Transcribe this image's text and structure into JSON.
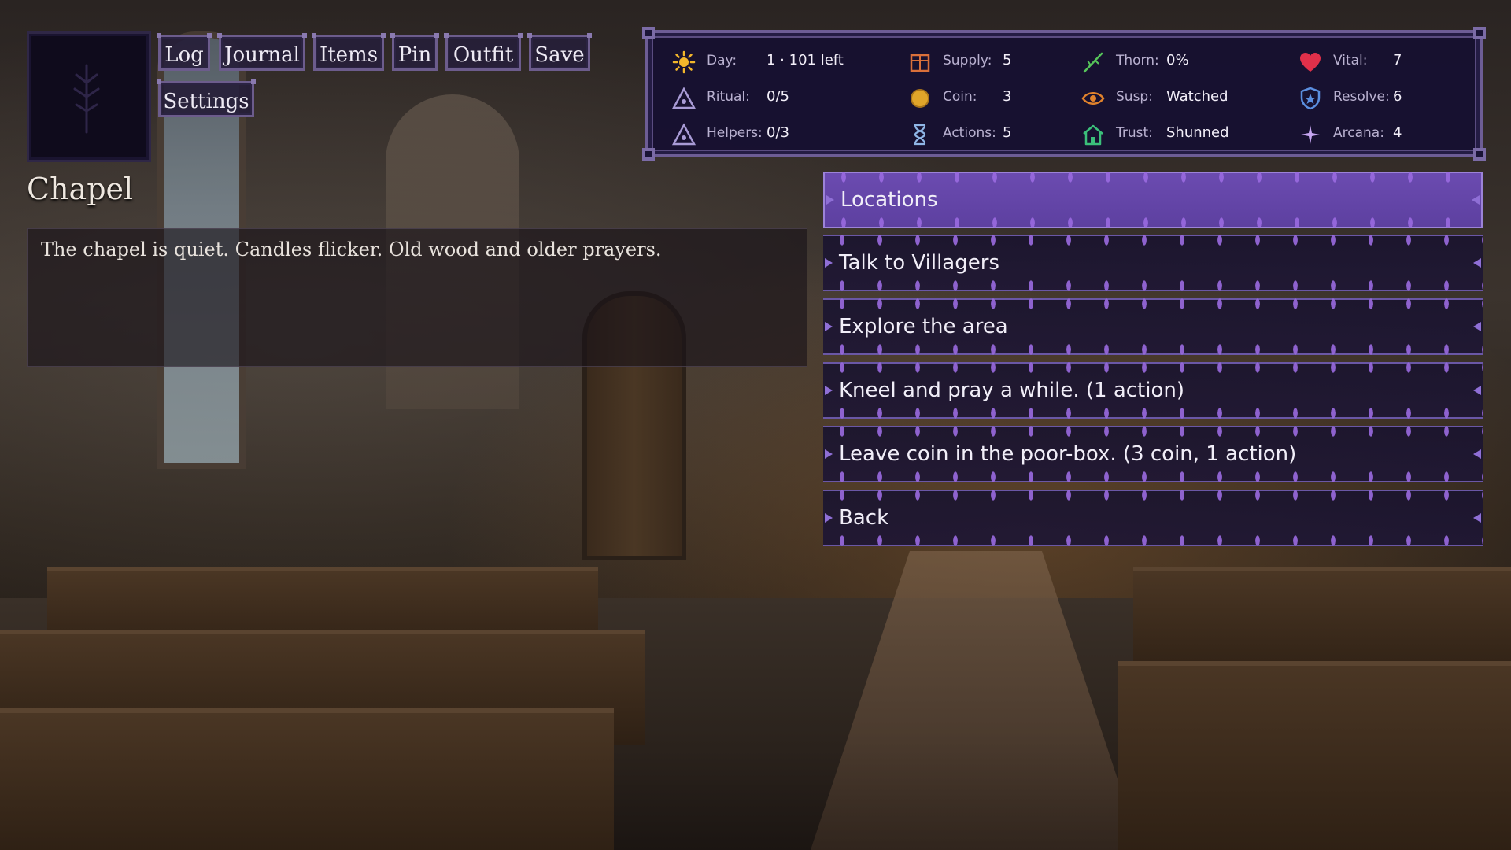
{
  "scene": {
    "location": "Chapel",
    "description": "The chapel is quiet. Candles flicker. Old wood and older prayers."
  },
  "nav": {
    "log": "Log",
    "journal": "Journal",
    "items": "Items",
    "pin": "Pin",
    "outfit": "Outfit",
    "save": "Save",
    "settings": "Settings"
  },
  "stats": {
    "day": {
      "label": "Day:",
      "value": "1 · 101 left",
      "icon": "sun-icon",
      "color": "#f2b62b"
    },
    "ritual": {
      "label": "Ritual:",
      "value": "0/5",
      "icon": "triangle-icon",
      "color": "#a99bd6"
    },
    "helpers": {
      "label": "Helpers:",
      "value": "0/3",
      "icon": "triangle-icon",
      "color": "#a99bd6"
    },
    "supply": {
      "label": "Supply:",
      "value": "5",
      "icon": "crate-icon",
      "color": "#d9703a"
    },
    "coin": {
      "label": "Coin:",
      "value": "3",
      "icon": "coin-icon",
      "color": "#e0a52a"
    },
    "actions": {
      "label": "Actions:",
      "value": "5",
      "icon": "hourglass-icon",
      "color": "#8fb6e6"
    },
    "thorn": {
      "label": "Thorn:",
      "value": "0%",
      "icon": "thorn-icon",
      "color": "#56c45a"
    },
    "susp": {
      "label": "Susp:",
      "value": "Watched",
      "icon": "eye-icon",
      "color": "#e0822c"
    },
    "trust": {
      "label": "Trust:",
      "value": "Shunned",
      "icon": "house-icon",
      "color": "#3bbf7a"
    },
    "vital": {
      "label": "Vital:",
      "value": "7",
      "icon": "heart-icon",
      "color": "#e0304a"
    },
    "resolve": {
      "label": "Resolve:",
      "value": "6",
      "icon": "shield-icon",
      "color": "#5b8fe0"
    },
    "arcana": {
      "label": "Arcana:",
      "value": "4",
      "icon": "sparkle-icon",
      "color": "#c7a6f2"
    }
  },
  "menu": [
    {
      "label": "Locations",
      "active": true
    },
    {
      "label": "Talk to Villagers"
    },
    {
      "label": "Explore the area"
    },
    {
      "label": "Kneel and pray a while. (1 action)"
    },
    {
      "label": "Leave coin in the poor-box. (3 coin, 1 action)"
    },
    {
      "label": "Back"
    }
  ]
}
